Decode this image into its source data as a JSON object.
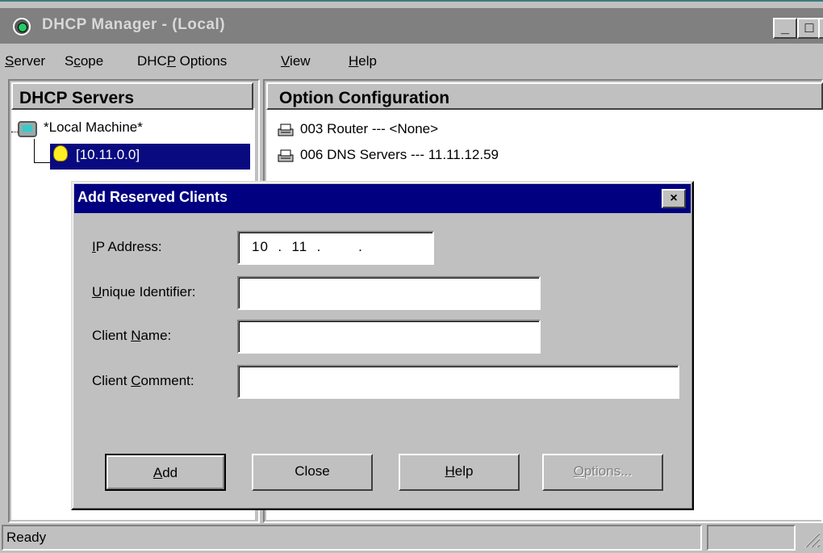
{
  "window": {
    "title": "DHCP Manager - (Local)",
    "minimize": "_",
    "maximize": "□",
    "close": "×"
  },
  "menu": {
    "items": [
      {
        "pre": "",
        "key": "S",
        "post": "erver"
      },
      {
        "pre": "S",
        "key": "c",
        "post": "ope"
      },
      {
        "pre": "DHC",
        "key": "P",
        "post": " Options"
      },
      {
        "pre": "",
        "key": "V",
        "post": "iew"
      },
      {
        "pre": "",
        "key": "H",
        "post": "elp"
      }
    ]
  },
  "left_pane": {
    "header": "DHCP Servers",
    "tree": [
      {
        "label": "*Local Machine*",
        "icon": "computer-icon"
      },
      {
        "label": "[10.11.0.0]",
        "icon": "lightbulb-icon",
        "selected": true
      }
    ]
  },
  "right_pane": {
    "header": "Option Configuration",
    "options": [
      {
        "text": "003  Router --- <None>",
        "icon": "option-icon"
      },
      {
        "text": "006  DNS Servers --- 11.11.12.59",
        "icon": "option-icon"
      }
    ]
  },
  "dialog": {
    "title": "Add Reserved Clients",
    "close": "×",
    "fields": {
      "ip": {
        "pre": "",
        "key": "I",
        "post": "P Address:",
        "value": "10  .  11  .        ."
      },
      "uid": {
        "pre": "",
        "key": "U",
        "post": "nique Identifier:",
        "value": ""
      },
      "name": {
        "pre": "Client ",
        "key": "N",
        "post": "ame:",
        "value": ""
      },
      "comment": {
        "pre": "Client ",
        "key": "C",
        "post": "omment:",
        "value": ""
      }
    },
    "buttons": {
      "add": {
        "pre": "",
        "key": "A",
        "post": "dd"
      },
      "close": "Close",
      "help": {
        "pre": "",
        "key": "H",
        "post": "elp"
      },
      "options": {
        "pre": "",
        "key": "O",
        "post": "ptions..."
      }
    }
  },
  "status": {
    "text": "Ready"
  }
}
